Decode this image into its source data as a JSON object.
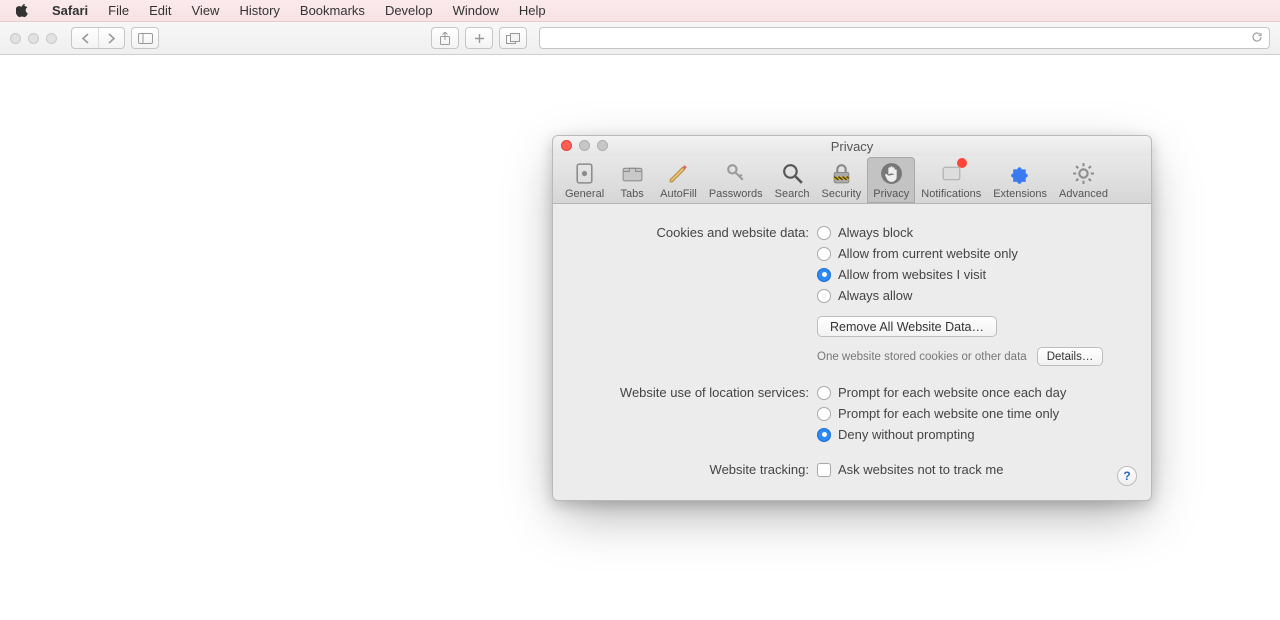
{
  "menubar": {
    "app": "Safari",
    "items": [
      "File",
      "Edit",
      "View",
      "History",
      "Bookmarks",
      "Develop",
      "Window",
      "Help"
    ]
  },
  "prefs": {
    "title": "Privacy",
    "tabs": {
      "general": "General",
      "tabs": "Tabs",
      "autofill": "AutoFill",
      "passwords": "Passwords",
      "search": "Search",
      "security": "Security",
      "privacy": "Privacy",
      "notifications": "Notifications",
      "extensions": "Extensions",
      "advanced": "Advanced"
    },
    "cookies": {
      "label": "Cookies and website data:",
      "opt_always_block": "Always block",
      "opt_current_only": "Allow from current website only",
      "opt_visited": "Allow from websites I visit",
      "opt_always_allow": "Always allow",
      "remove_btn": "Remove All Website Data…",
      "stored_note": "One website stored cookies or other data",
      "details_btn": "Details…"
    },
    "location": {
      "label": "Website use of location services:",
      "opt_daily": "Prompt for each website once each day",
      "opt_once": "Prompt for each website one time only",
      "opt_deny": "Deny without prompting"
    },
    "tracking": {
      "label": "Website tracking:",
      "opt_dnt": "Ask websites not to track me"
    },
    "help": "?"
  }
}
